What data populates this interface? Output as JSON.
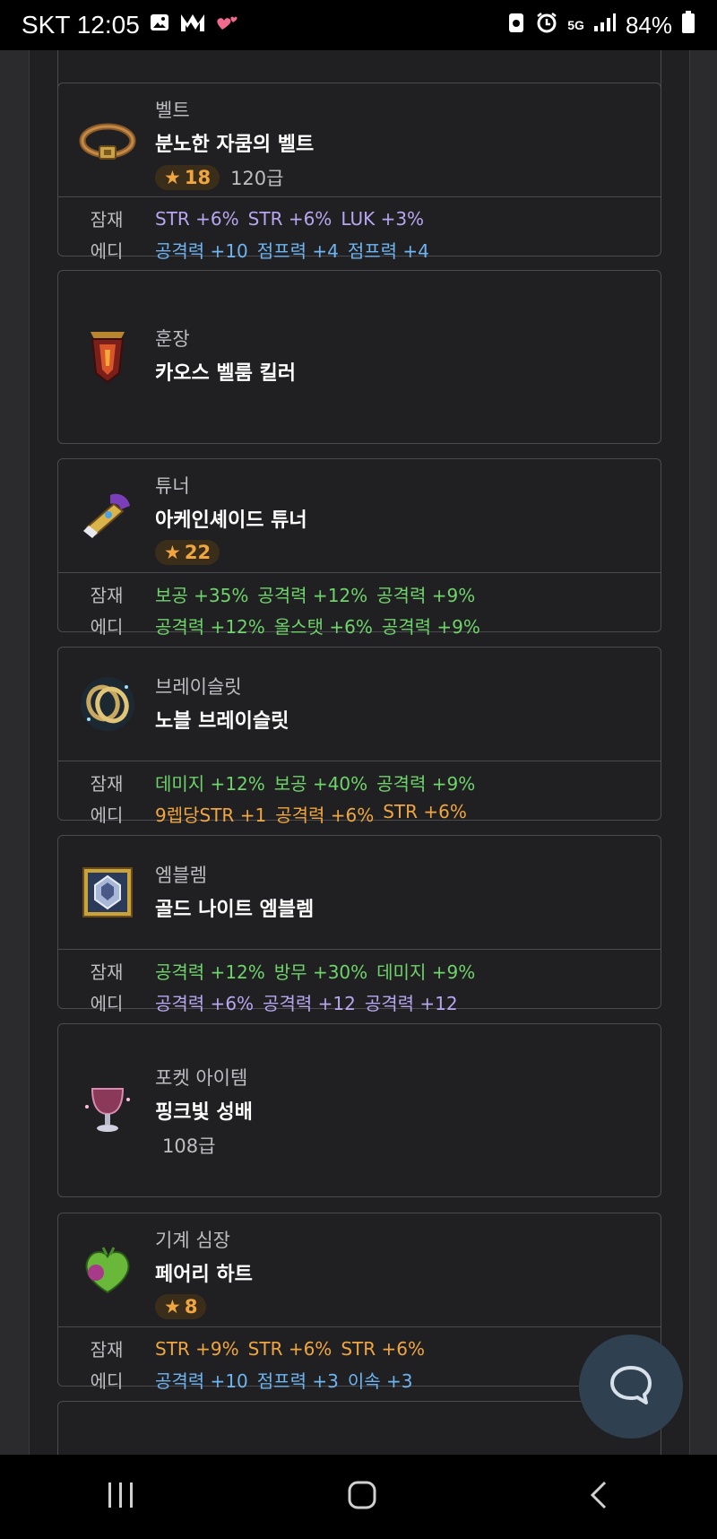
{
  "status": {
    "carrier_time": "SKT 12:05",
    "battery": "84%",
    "network": "5G"
  },
  "items": [
    {
      "type": "벨트",
      "name": "분노한 자쿰의 벨트",
      "star": "18",
      "level": "120급",
      "icon": "belt-icon",
      "potential": {
        "label": "잠재",
        "values": [
          "STR +6%",
          "STR +6%",
          "LUK +3%"
        ],
        "color": "#b7a6f0"
      },
      "additional": {
        "label": "에디",
        "values": [
          "공격력 +10",
          "점프력 +4",
          "점프력 +4"
        ],
        "color": "#6db4f0"
      }
    },
    {
      "type": "훈장",
      "name": "카오스 벨룸 킬러",
      "icon": "medal-icon"
    },
    {
      "type": "튜너",
      "name": "아케인셰이드 튜너",
      "star": "22",
      "icon": "tuner-icon",
      "potential": {
        "label": "잠재",
        "values": [
          "보공 +35%",
          "공격력 +12%",
          "공격력 +9%"
        ],
        "color": "#6ed36a"
      },
      "additional": {
        "label": "에디",
        "values": [
          "공격력 +12%",
          "올스탯 +6%",
          "공격력 +9%"
        ],
        "color": "#6ed36a"
      }
    },
    {
      "type": "브레이슬릿",
      "name": "노블 브레이슬릿",
      "icon": "bracelet-icon",
      "potential": {
        "label": "잠재",
        "values": [
          "데미지 +12%",
          "보공 +40%",
          "공격력 +9%"
        ],
        "color": "#6ed36a"
      },
      "additional": {
        "label": "에디",
        "values": [
          "9렙당STR +1",
          "공격력 +6%",
          "STR +6%"
        ],
        "color": "#f0a640"
      }
    },
    {
      "type": "엠블렘",
      "name": "골드 나이트 엠블렘",
      "icon": "emblem-icon",
      "potential": {
        "label": "잠재",
        "values": [
          "공격력 +12%",
          "방무 +30%",
          "데미지 +9%"
        ],
        "color": "#6ed36a"
      },
      "additional": {
        "label": "에디",
        "values": [
          "공격력 +6%",
          "공격력 +12",
          "공격력 +12"
        ],
        "color": "#b7a6f0"
      }
    },
    {
      "type": "포켓 아이템",
      "name": "핑크빛 성배",
      "level": "108급",
      "icon": "chalice-icon"
    },
    {
      "type": "기계 심장",
      "name": "페어리 하트",
      "star": "8",
      "icon": "heart-icon",
      "potential": {
        "label": "잠재",
        "values": [
          "STR +9%",
          "STR +6%",
          "STR +6%"
        ],
        "color": "#f0a640"
      },
      "additional": {
        "label": "에디",
        "values": [
          "공격력 +10",
          "점프력 +3",
          "이속 +3"
        ],
        "color": "#6db4f0"
      }
    }
  ],
  "star_symbol": "★",
  "chat_icon": "chat-bubble-icon",
  "nav": [
    "recent-apps-icon",
    "home-icon",
    "back-icon"
  ]
}
